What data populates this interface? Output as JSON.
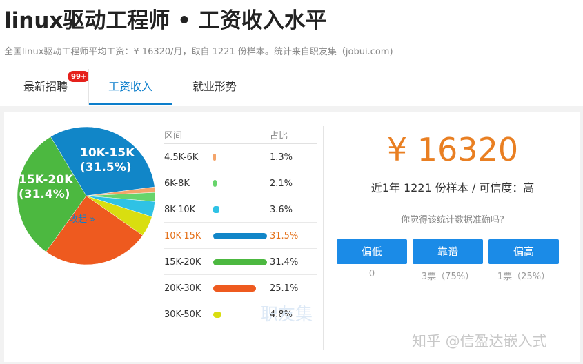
{
  "header": {
    "title": "linux驱动工程师 • 工资收入水平",
    "subtitle": "全国linux驱动工程师平均工资：¥ 16320/月，取自 1221 份样本。统计来自职友集（jobui.com)"
  },
  "tabs": [
    {
      "label": "最新招聘",
      "badge": "99+"
    },
    {
      "label": "工资收入",
      "active": true
    },
    {
      "label": "就业形势"
    }
  ],
  "chart_data": {
    "type": "pie",
    "slices": [
      {
        "label": "4.5K-6K",
        "value": 1.3,
        "color": "#f4a46a"
      },
      {
        "label": "6K-8K",
        "value": 2.1,
        "color": "#67d46b"
      },
      {
        "label": "8K-10K",
        "value": 3.6,
        "color": "#2fc2e5"
      },
      {
        "label": "10K-15K",
        "value": 31.5,
        "color": "#1186c8"
      },
      {
        "label": "15K-20K",
        "value": 31.4,
        "color": "#4cb840"
      },
      {
        "label": "20K-30K",
        "value": 25.1,
        "color": "#ee5a1f"
      },
      {
        "label": "30K-50K",
        "value": 4.8,
        "color": "#d9de10"
      }
    ],
    "labels_on_chart": [
      {
        "text": "10K-15K\n(31.5%)"
      },
      {
        "text": "15K-20K\n(31.4%)"
      }
    ]
  },
  "table": {
    "header_range": "区间",
    "header_pct": "占比",
    "rows": [
      {
        "range": "4.5K-6K",
        "pct": "1.3%",
        "value": 1.3,
        "color": "#f4a46a",
        "highlight": false
      },
      {
        "range": "6K-8K",
        "pct": "2.1%",
        "value": 2.1,
        "color": "#67d46b",
        "highlight": false
      },
      {
        "range": "8K-10K",
        "pct": "3.6%",
        "value": 3.6,
        "color": "#2fc2e5",
        "highlight": false
      },
      {
        "range": "10K-15K",
        "pct": "31.5%",
        "value": 31.5,
        "color": "#1186c8",
        "highlight": true
      },
      {
        "range": "15K-20K",
        "pct": "31.4%",
        "value": 31.4,
        "color": "#4cb840",
        "highlight": false
      },
      {
        "range": "20K-30K",
        "pct": "25.1%",
        "value": 25.1,
        "color": "#ee5a1f",
        "highlight": false
      },
      {
        "range": "30K-50K",
        "pct": "4.8%",
        "value": 4.8,
        "color": "#d9de10",
        "highlight": false
      }
    ],
    "collapse_label": "收起 »",
    "watermark": "职友集"
  },
  "summary": {
    "salary": "¥ 16320",
    "sample": "近1年 1221 份样本 / 可信度：高",
    "question": "你觉得该统计数据准确吗?",
    "votes": [
      {
        "label": "偏低",
        "count": "0"
      },
      {
        "label": "靠谱",
        "count": "3票（75%）"
      },
      {
        "label": "偏高",
        "count": "1票（25%）"
      }
    ]
  },
  "watermark": "知乎 @信盈达嵌入式"
}
